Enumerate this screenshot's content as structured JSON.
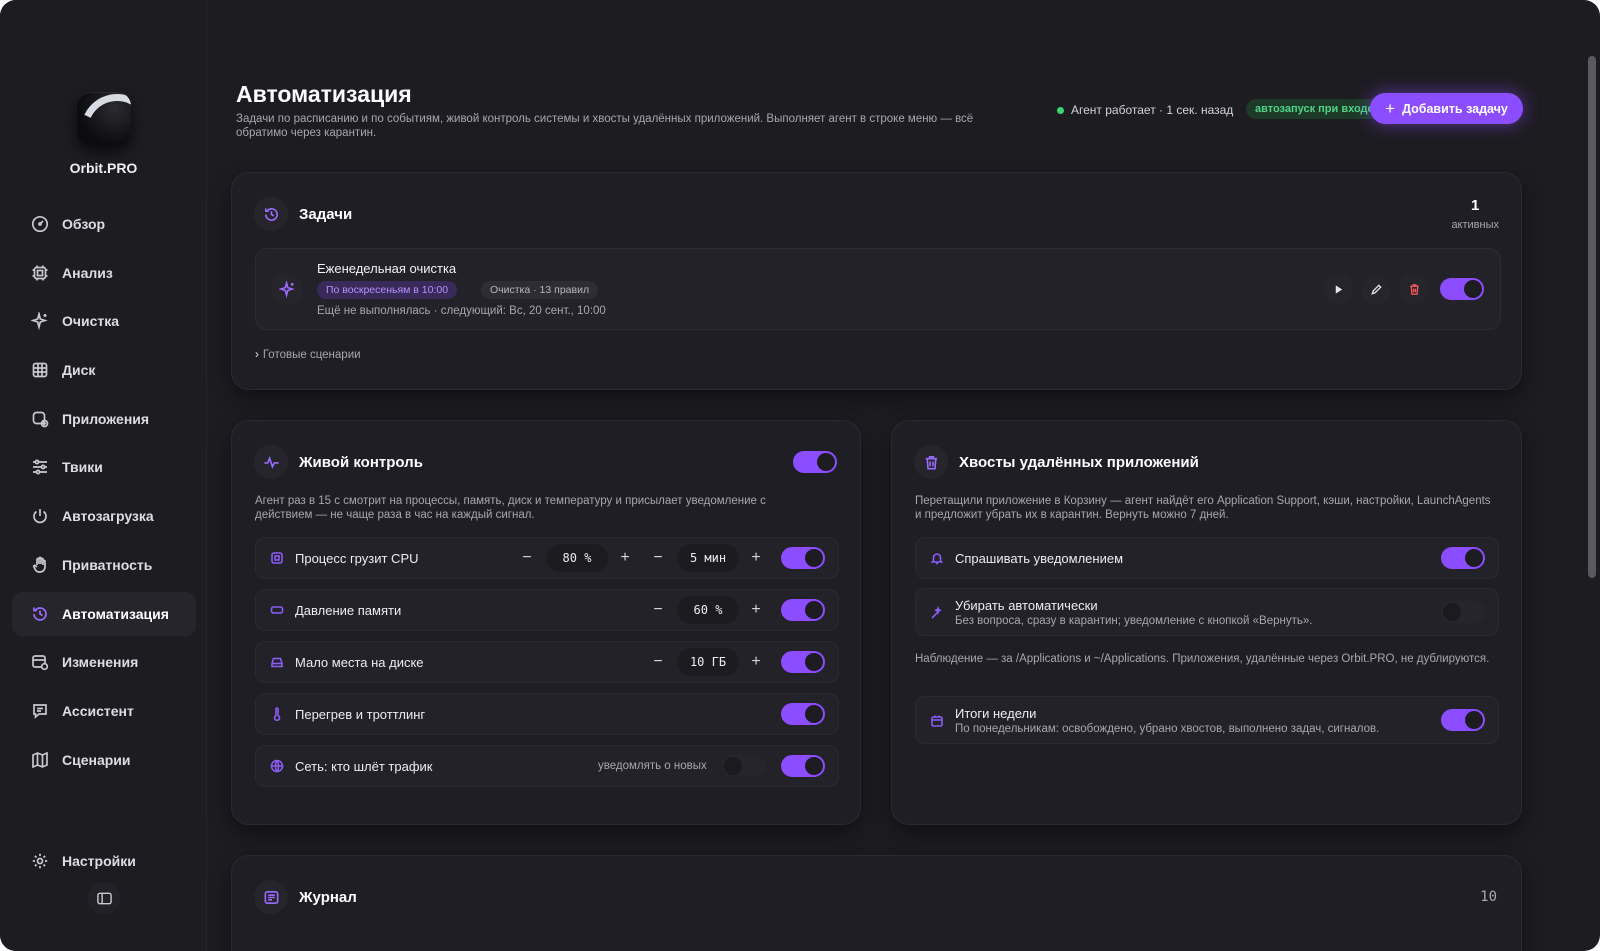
{
  "app": {
    "name": "Orbit.PRO"
  },
  "sidebar": {
    "items": [
      {
        "label": "Обзор",
        "icon": "gauge-icon"
      },
      {
        "label": "Анализ",
        "icon": "chip-icon"
      },
      {
        "label": "Очистка",
        "icon": "sparkles-icon"
      },
      {
        "label": "Диск",
        "icon": "grid-icon"
      },
      {
        "label": "Приложения",
        "icon": "app-check-icon"
      },
      {
        "label": "Твики",
        "icon": "sliders-icon"
      },
      {
        "label": "Автозагрузка",
        "icon": "power-icon"
      },
      {
        "label": "Приватность",
        "icon": "hand-icon"
      },
      {
        "label": "Автоматизация",
        "icon": "history-icon",
        "active": true
      },
      {
        "label": "Изменения",
        "icon": "changes-icon"
      },
      {
        "label": "Ассистент",
        "icon": "chat-icon"
      },
      {
        "label": "Сценарии",
        "icon": "map-icon"
      }
    ],
    "settings": "Настройки"
  },
  "header": {
    "title": "Автоматизация",
    "subtitle": "Задачи по расписанию и по событиям, живой контроль системы и хвосты удалённых приложений. Выполняет агент в строке меню — всё обратимо через карантин.",
    "status": "Агент работает · 1 сек. назад",
    "autostart_badge": "автозапуск при входе",
    "add_button": "Добавить задачу"
  },
  "tasks": {
    "title": "Задачи",
    "active_count": "1",
    "active_label": "активных",
    "items": [
      {
        "name": "Еженедельная очистка",
        "schedule": "По воскресеньям в 10:00",
        "category": "Очистка · 13 правил",
        "meta": "Ещё не выполнялась  · следующий: Вс, 20 сент., 10:00",
        "enabled": true
      }
    ],
    "ready_scenarios": "Готовые сценарии"
  },
  "live": {
    "title": "Живой контроль",
    "enabled": true,
    "description": "Агент раз в 15 с смотрит на процессы, память, диск и температуру и присылает уведомление с действием — не чаще раза в час на каждый сигнал.",
    "rules": [
      {
        "label": "Процесс грузит CPU",
        "value1": "80 %",
        "value2": "5 мин",
        "enabled": true
      },
      {
        "label": "Давление памяти",
        "value2": "60 %",
        "enabled": true
      },
      {
        "label": "Мало места на диске",
        "value2": "10 ГБ",
        "enabled": true
      },
      {
        "label": "Перегрев и троттлинг",
        "enabled": true
      },
      {
        "label": "Сеть: кто шлёт трафик",
        "notify_label": "уведомлять о новых",
        "notify_enabled": false,
        "enabled": true
      }
    ]
  },
  "tails": {
    "title": "Хвосты удалённых приложений",
    "description": "Перетащили приложение в Корзину — агент найдёт его Application Support, кэши, настройки, LaunchAgents и предложит убрать их в карантин. Вернуть можно 7 дней.",
    "ask": {
      "label": "Спрашивать уведомлением",
      "enabled": true
    },
    "auto": {
      "label": "Убирать автоматически",
      "sub": "Без вопроса, сразу в карантин; уведомление с кнопкой «Вернуть».",
      "enabled": false
    },
    "note": "Наблюдение — за /Applications и ~/Applications. Приложения, удалённые через Orbit.PRO, не дублируются.",
    "weekly": {
      "label": "Итоги недели",
      "sub": "По понедельникам: освобождено, убрано хвостов, выполнено задач, сигналов.",
      "enabled": true
    }
  },
  "journal": {
    "title": "Журнал",
    "count": "10"
  },
  "colors": {
    "accent": "#8b4dff",
    "status_ok": "#3bd671",
    "background": "#1d1c21"
  }
}
